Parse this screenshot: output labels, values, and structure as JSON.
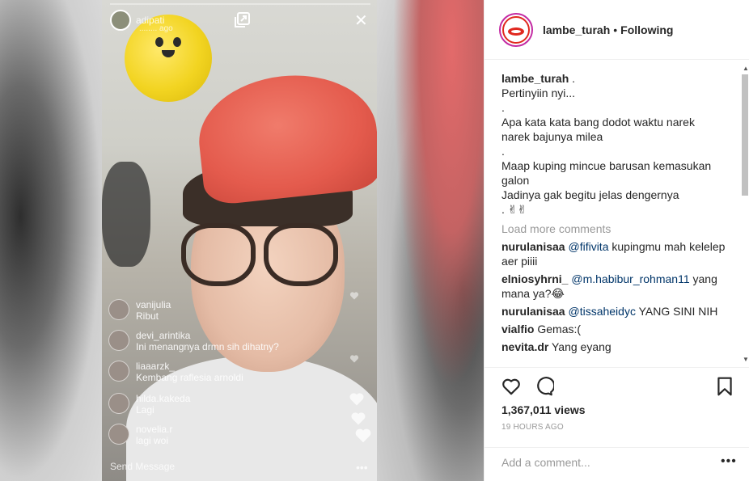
{
  "live": {
    "username": "adipati",
    "subtitle": "........ ago",
    "chat": [
      {
        "user": "vanijulia",
        "msg": "Ribut"
      },
      {
        "user": "devi_arintika",
        "msg": "Ini menangnya drmn sih dihatny?"
      },
      {
        "user": "liaaarzk_",
        "msg": "Kembang raflesia arnoldi"
      },
      {
        "user": "hilda.kakeda",
        "msg": "Lagi"
      },
      {
        "user": "novelia.r",
        "msg": "lagi woi"
      }
    ],
    "send_placeholder": "Send Message",
    "more_label": "•••",
    "close_label": "✕"
  },
  "post": {
    "username": "lambe_turah",
    "separator": "•",
    "follow_status": "Following",
    "caption_user": "lambe_turah",
    "caption_lines": [
      " .",
      "Pertinyiin nyi...",
      ".",
      "Apa kata kata bang dodot waktu narek narek bajunya milea",
      ".",
      "Maap kuping mincue barusan kemasukan galon",
      "Jadinya gak begitu jelas dengernya",
      ". ✌✌"
    ],
    "load_more": "Load more comments",
    "comments": [
      {
        "user": "nurulanisaa",
        "mention": "@fifivita",
        "text": " kupingmu mah kelelep aer piiii"
      },
      {
        "user": "elniosyhrni_",
        "mention": "@m.habibur_rohman11",
        "text": " yang mana ya?😂"
      },
      {
        "user": "nurulanisaa",
        "mention": "@tissaheidyc",
        "text": " YANG SINI NIH"
      },
      {
        "user": "vialfio",
        "mention": "",
        "text": "Gemas:("
      },
      {
        "user": "nevita.dr",
        "mention": "",
        "text": "Yang eyang"
      }
    ],
    "views": "1,367,011 views",
    "time_ago": "19 HOURS AGO",
    "add_comment_placeholder": "Add a comment...",
    "options_label": "•••"
  },
  "colors": {
    "mention": "#003569",
    "muted": "#999999",
    "text": "#262626",
    "avatar_ring": "#c32aa3",
    "brand_red": "#e0281f"
  },
  "icons": [
    "heart-icon",
    "comment-icon",
    "bookmark-icon",
    "expand-icon",
    "close-icon"
  ]
}
